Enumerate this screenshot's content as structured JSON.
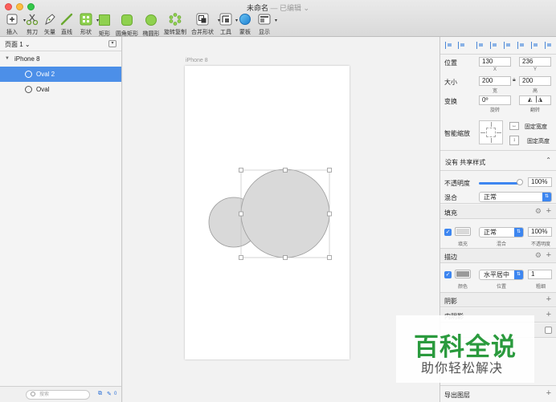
{
  "window": {
    "title": "未命名",
    "separator": "—",
    "status": "已编辑 ⌄"
  },
  "toolbar": {
    "items": [
      {
        "label": "插入",
        "icon": "plus-icon"
      },
      {
        "label": "剪刀",
        "icon": "scissors-icon"
      },
      {
        "label": "矢量",
        "icon": "pen-icon"
      },
      {
        "label": "直线",
        "icon": "line-icon"
      },
      {
        "label": "形状",
        "icon": "shapes-icon"
      },
      {
        "label": "矩形",
        "icon": "rectangle-icon"
      },
      {
        "label": "圆角矩形",
        "icon": "rounded-rectangle-icon"
      },
      {
        "label": "椭圆形",
        "icon": "oval-icon"
      },
      {
        "label": "旋转复制",
        "icon": "rotate-copy-icon"
      },
      {
        "label": "合并形状",
        "icon": "combine-shapes-icon"
      },
      {
        "label": "工具",
        "icon": "tools-icon"
      },
      {
        "label": "蒙板",
        "icon": "mask-icon"
      },
      {
        "label": "显示",
        "icon": "view-icon"
      }
    ]
  },
  "layers": {
    "page_selector": "页面 1 ⌄",
    "artboard": "iPhone 8",
    "children": [
      {
        "name": "Oval 2",
        "selected": true
      },
      {
        "name": "Oval",
        "selected": false
      }
    ],
    "search_placeholder": "搜索",
    "filter_count": "0"
  },
  "canvas": {
    "artboard_label": "iPhone 8",
    "oval_fill": "#d9d9d9",
    "oval_stroke": "#9a9a9a"
  },
  "inspector": {
    "position_label": "位置",
    "x": "130",
    "y": "236",
    "x_sub": "X",
    "y_sub": "Y",
    "size_label": "大小",
    "width": "200",
    "height": "200",
    "width_sub": "宽",
    "height_sub": "高",
    "transform_label": "变换",
    "rotation": "0º",
    "rotation_sub": "旋转",
    "flip_sub": "翻转",
    "resizing_label": "智能缩放",
    "fix_width": "固定宽度",
    "fix_height": "固定高度",
    "shared_style": "没有 共享样式",
    "opacity_label": "不透明度",
    "opacity_value": "100%",
    "blending_label": "混合",
    "blending_value": "正常",
    "fill_title": "填充",
    "fill_blend": "正常",
    "fill_opacity": "100%",
    "fill_sub_color": "填充",
    "fill_sub_blend": "混合",
    "fill_sub_opacity": "不透明度",
    "fill_color": "#d9d9d9",
    "border_title": "描边",
    "border_position": "水平居中",
    "border_thickness": "1",
    "border_sub_color": "颜色",
    "border_sub_position": "位置",
    "border_sub_thickness": "粗细",
    "border_color": "#9a9a9a",
    "shadow_title": "阴影",
    "inner_shadow_title": "内阴影",
    "export_title": "导出图层"
  },
  "watermark": {
    "main": "百科全说",
    "sub": "助你轻松解决"
  }
}
